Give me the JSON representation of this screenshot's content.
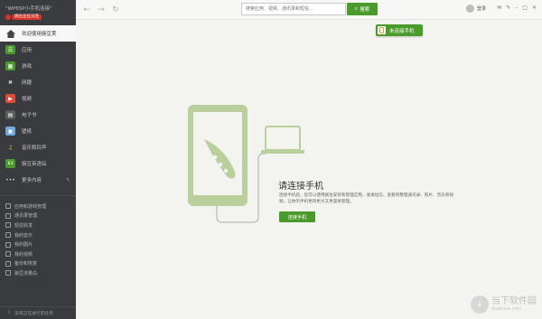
{
  "sidebar": {
    "brand_title": "\"WP6SP小手机连接\"",
    "brand_badge": "豌豆豆豆没连",
    "home": {
      "label": "欢迎使用豌豆荚"
    },
    "items": [
      {
        "label": "应用",
        "icon": "app-icon",
        "color": "#4a9b2c",
        "glyph": "☰"
      },
      {
        "label": "游戏",
        "icon": "game-icon",
        "color": "#4a9b2c",
        "glyph": "▦"
      },
      {
        "label": "网趣",
        "icon": "close-x-icon",
        "color": "transparent",
        "glyph": "✖"
      },
      {
        "label": "视频",
        "icon": "video-icon",
        "color": "#e04a3b",
        "glyph": "▶"
      },
      {
        "label": "电子书",
        "icon": "ebook-icon",
        "color": "#5c5c5c",
        "glyph": "▤"
      },
      {
        "label": "壁纸",
        "icon": "wallpaper-icon",
        "color": "#6fa8dc",
        "glyph": "▣"
      },
      {
        "label": "音乐和铃声",
        "icon": "music-icon",
        "color": "transparent",
        "glyph": "♫"
      },
      {
        "label": "豌豆英语坛",
        "icon": "english-icon",
        "color": "#4a9b2c",
        "glyph": "B3"
      },
      {
        "label": "更多内容",
        "icon": "more-icon",
        "color": "transparent",
        "glyph": "•••"
      }
    ],
    "tools": [
      "应用和游戏管理",
      "通讯录管理",
      "短信收发",
      "我的音乐",
      "我的图片",
      "我的视频",
      "备份和恢复",
      "豌豆流量白"
    ],
    "bottom_label": "没有正在进行的任务"
  },
  "topbar": {
    "search_placeholder": "搜索应用、视频、通讯录和短信...",
    "search_button": "搜索",
    "login": "登录"
  },
  "connect_pill": {
    "label": "未连接手机"
  },
  "main": {
    "title": "请连接手机",
    "desc": "连接手机后，您可以使用豌豆安装和管理应用，收发短信，查看和整理通讯录、照片、音乐和视频，让你的手机更快更大又更容易管理。",
    "button": "连接手机"
  },
  "watermark": {
    "title": "当下软件园",
    "url": "downxia.com"
  },
  "colors": {
    "accent": "#4a9b2c",
    "sidebar_bg": "#3a3b3e",
    "page_bg": "#f3f3ef",
    "illustration": "#b9cf9c"
  }
}
